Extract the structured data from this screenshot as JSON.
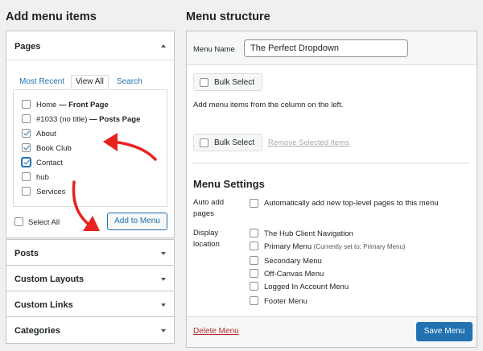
{
  "left": {
    "heading": "Add menu items",
    "pages_panel": {
      "title": "Pages",
      "tabs": [
        "Most Recent",
        "View All",
        "Search"
      ],
      "items": [
        {
          "label": "Home",
          "suffix": " — Front Page",
          "checked": false
        },
        {
          "label": "#1033 (no title)",
          "suffix": " — Posts Page",
          "checked": false
        },
        {
          "label": "About",
          "suffix": "",
          "checked": true
        },
        {
          "label": "Book Club",
          "suffix": "",
          "checked": true
        },
        {
          "label": "Contact",
          "suffix": "",
          "checked": true
        },
        {
          "label": "hub",
          "suffix": "",
          "checked": false
        },
        {
          "label": "Services",
          "suffix": "",
          "checked": false
        }
      ],
      "select_all": "Select All",
      "add_button": "Add to Menu"
    },
    "collapsed_panels": [
      "Posts",
      "Custom Layouts",
      "Custom Links",
      "Categories"
    ]
  },
  "right": {
    "heading": "Menu structure",
    "menu_name_label": "Menu Name",
    "menu_name_value": "The Perfect Dropdown",
    "bulk_select": "Bulk Select",
    "empty_hint": "Add menu items from the column on the left.",
    "remove_selected": "Remove Selected Items",
    "settings_heading": "Menu Settings",
    "auto_add_label_1": "Auto add",
    "auto_add_label_2": "pages",
    "auto_add_option": "Automatically add new top-level pages to this menu",
    "display_label_1": "Display",
    "display_label_2": "location",
    "locations": [
      {
        "label": "The Hub Client Navigation",
        "note": ""
      },
      {
        "label": "Primary Menu",
        "note": "(Currently set to: Primary Menu)"
      },
      {
        "label": "Secondary Menu",
        "note": ""
      },
      {
        "label": "Off-Canvas Menu",
        "note": ""
      },
      {
        "label": "Logged In Account Menu",
        "note": ""
      },
      {
        "label": "Footer Menu",
        "note": ""
      }
    ],
    "delete_menu": "Delete Menu",
    "save_menu": "Save Menu"
  },
  "colors": {
    "accent": "#2271b1",
    "annotation_arrow": "#e8231f",
    "danger": "#b32d2e"
  }
}
